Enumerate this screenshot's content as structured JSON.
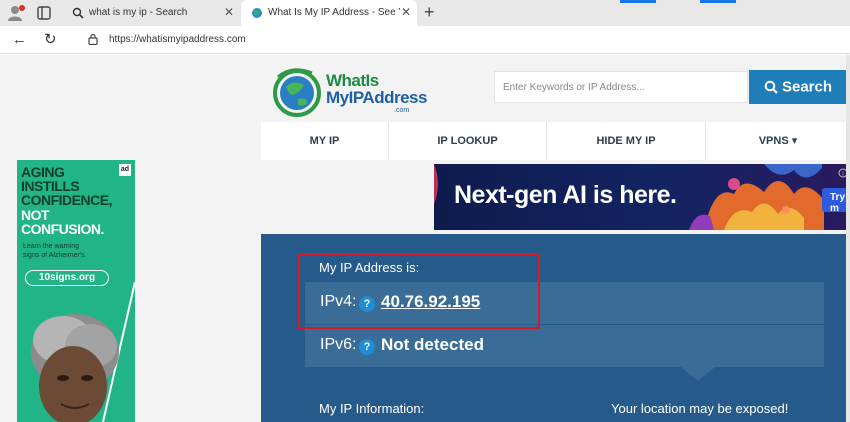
{
  "browser": {
    "tabs": [
      {
        "title": "what is my ip - Search",
        "active": false
      },
      {
        "title": "What Is My IP Address - See Your",
        "active": true
      }
    ],
    "new_tab_label": "+",
    "close_glyph": "✕",
    "address": "https://whatismyipaddress.com",
    "back_glyph": "←",
    "reload_glyph": "↻"
  },
  "site": {
    "logo": {
      "line1": "WhatIs",
      "line2": "MyIPAddress",
      "line3": ".com"
    },
    "search": {
      "placeholder": "Enter Keywords or IP Address...",
      "button_label": "Search"
    },
    "nav": [
      "MY IP",
      "IP LOOKUP",
      "HIDE MY IP",
      "VPNS ▾"
    ],
    "brand_color": "#1f7db9",
    "card_color": "#265a8a"
  },
  "banner_ad": {
    "headline": "Next-gen AI is here.",
    "cta": "Try m"
  },
  "side_ad": {
    "badge": "ad",
    "headline_lines": [
      "AGING",
      "INSTILLS",
      "CONFIDENCE,",
      "NOT",
      "CONFUSION."
    ],
    "small_text": [
      "Learn the warning",
      "signs of Alzheimer's."
    ],
    "link": "10signs.org"
  },
  "ip_info": {
    "label": "My IP Address is:",
    "ipv4_label": "IPv4:",
    "ipv4_value": "40.76.92.195",
    "ipv6_label": "IPv6:",
    "ipv6_value": "Not detected",
    "help_glyph": "?",
    "info_label": "My IP Information:",
    "warning": "Your location may be exposed!",
    "highlight_color": "#d21b2a"
  }
}
